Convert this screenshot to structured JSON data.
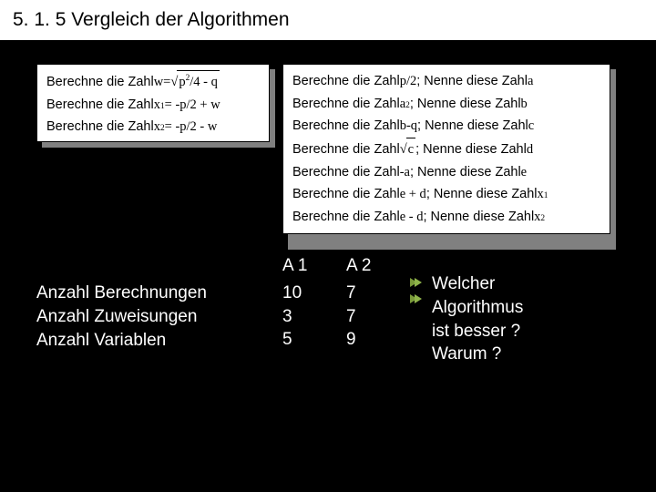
{
  "title": "5. 1. 5  Vergleich der Algorithmen",
  "algo1": {
    "l1a": "Berechne die Zahl ",
    "l1b": "w",
    "l1c": " = ",
    "l1d": "p",
    "l1e": "2",
    "l1f": "/4 - q",
    "l2a": "Berechne die Zahl ",
    "l2b": "x",
    "l2c": "1",
    "l2d": " = -p/2 + w",
    "l3a": "Berechne die Zahl ",
    "l3b": "x",
    "l3c": "2",
    "l3d": " = -p/2 - w"
  },
  "algo2": {
    "l1a": "Berechne die Zahl ",
    "l1b": "p/2",
    "l1c": "; Nenne diese Zahl ",
    "l1d": "a",
    "l2a": "Berechne die Zahl ",
    "l2b": "a",
    "l2c": "2",
    "l2d": "; Nenne diese Zahl ",
    "l2e": "b",
    "l3a": "Berechne die Zahl ",
    "l3b": "b-q",
    "l3c": "; Nenne diese Zahl ",
    "l3d": "c",
    "l4a": "Berechne die Zahl ",
    "l4b": "c",
    "l4c": " ; Nenne diese Zahl ",
    "l4d": "d",
    "l5a": "Berechne die Zahl ",
    "l5b": "-a",
    "l5c": "; Nenne diese Zahl ",
    "l5d": "e",
    "l6a": "Berechne die Zahl ",
    "l6b": "e + d",
    "l6c": "; Nenne diese Zahl ",
    "l6d": "x",
    "l6e": "1",
    "l7a": "Berechne die Zahl ",
    "l7b": "e - d",
    "l7c": "; Nenne diese Zahl ",
    "l7d": "x",
    "l7e": "2"
  },
  "labels": {
    "r1": "Anzahl Berechnungen",
    "r2": "Anzahl Zuweisungen",
    "r3": "Anzahl Variablen"
  },
  "colA": {
    "hd": "A 1",
    "v1": "10",
    "v2": "3",
    "v3": "5"
  },
  "colB": {
    "hd": "A 2",
    "v1": "7",
    "v2": "7",
    "v3": "9"
  },
  "question": {
    "l1": "Welcher",
    "l2": "Algorithmus",
    "l3": "ist besser ?",
    "l4": "Warum ?"
  }
}
